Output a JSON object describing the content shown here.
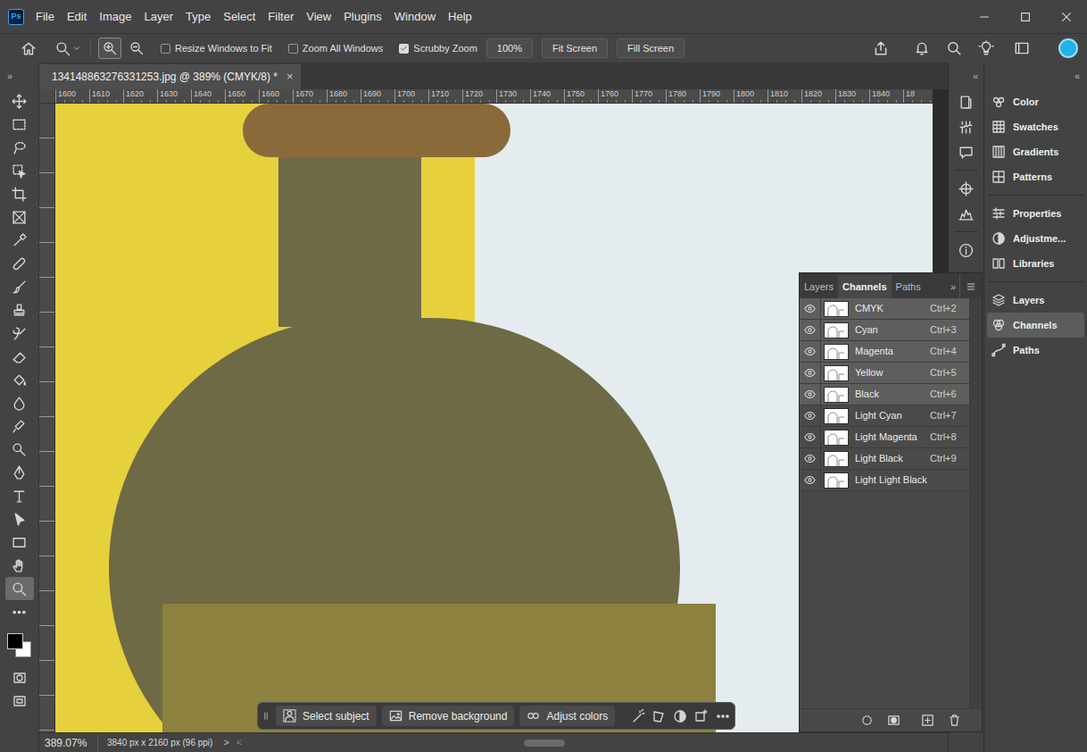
{
  "app": {
    "logo": "Ps"
  },
  "menu": [
    "File",
    "Edit",
    "Image",
    "Layer",
    "Type",
    "Select",
    "Filter",
    "View",
    "Plugins",
    "Window",
    "Help"
  ],
  "options_bar": {
    "zoom_modes": [
      {
        "selected": true
      },
      {
        "selected": false
      }
    ],
    "checkboxes": [
      {
        "label": "Resize Windows to Fit",
        "checked": false
      },
      {
        "label": "Zoom All Windows",
        "checked": false
      },
      {
        "label": "Scrubby Zoom",
        "checked": true
      }
    ],
    "buttons": [
      "100%",
      "Fit Screen",
      "Fill Screen"
    ]
  },
  "collapse": {
    "toolbar": "»",
    "strip": "«",
    "panel": "«"
  },
  "document_tab": {
    "title": "134148863276331253.jpg @ 389% (CMYK/8) *",
    "close": "×"
  },
  "ruler": {
    "ticks": [
      "1600",
      "1610",
      "1620",
      "1630",
      "1640",
      "1650",
      "1660",
      "1670",
      "1680",
      "1690",
      "1700",
      "1710",
      "1720",
      "1730",
      "1740",
      "1750",
      "1760",
      "1770",
      "1780",
      "1790",
      "1800",
      "1810",
      "1820",
      "1830",
      "1840",
      "18"
    ]
  },
  "tools": [
    {
      "selected": false
    },
    {
      "selected": false
    },
    {
      "selected": false
    },
    {
      "selected": false
    },
    {
      "selected": false
    },
    {
      "selected": false
    },
    {
      "selected": false
    },
    {
      "selected": false
    },
    {
      "selected": false
    },
    {
      "selected": false
    },
    {
      "selected": false
    },
    {
      "selected": false
    },
    {
      "selected": false
    },
    {
      "selected": false
    },
    {
      "selected": false
    },
    {
      "selected": false
    },
    {
      "selected": false
    },
    {
      "selected": false
    },
    {
      "selected": false
    },
    {
      "selected": false
    },
    {
      "selected": false
    },
    {
      "selected": true
    },
    {
      "selected": false
    }
  ],
  "channels_panel": {
    "tabs": [
      {
        "label": "Layers",
        "selected": false
      },
      {
        "label": "Channels",
        "selected": true
      },
      {
        "label": "Paths",
        "selected": false
      }
    ],
    "more": "»",
    "channels": [
      {
        "name": "CMYK",
        "shortcut": "Ctrl+2",
        "selected": true,
        "visible": true
      },
      {
        "name": "Cyan",
        "shortcut": "Ctrl+3",
        "selected": true,
        "visible": true
      },
      {
        "name": "Magenta",
        "shortcut": "Ctrl+4",
        "selected": true,
        "visible": true
      },
      {
        "name": "Yellow",
        "shortcut": "Ctrl+5",
        "selected": true,
        "visible": true
      },
      {
        "name": "Black",
        "shortcut": "Ctrl+6",
        "selected": true,
        "visible": true
      },
      {
        "name": "Light Cyan",
        "shortcut": "Ctrl+7",
        "selected": false,
        "visible": true
      },
      {
        "name": "Light Magenta",
        "shortcut": "Ctrl+8",
        "selected": false,
        "visible": true
      },
      {
        "name": "Light Black",
        "shortcut": "Ctrl+9",
        "selected": false,
        "visible": true
      },
      {
        "name": "Light Light Black",
        "shortcut": "",
        "selected": false,
        "visible": true
      }
    ]
  },
  "right_panel": {
    "groups": [
      [
        {
          "label": "Color",
          "selected": false
        },
        {
          "label": "Swatches",
          "selected": false
        },
        {
          "label": "Gradients",
          "selected": false
        },
        {
          "label": "Patterns",
          "selected": false
        }
      ],
      [
        {
          "label": "Properties",
          "selected": false
        },
        {
          "label": "Adjustme...",
          "selected": false
        },
        {
          "label": "Libraries",
          "selected": false
        }
      ],
      [
        {
          "label": "Layers",
          "selected": false
        },
        {
          "label": "Channels",
          "selected": true
        },
        {
          "label": "Paths",
          "selected": false
        }
      ]
    ]
  },
  "task_bar": {
    "buttons": [
      "Select subject",
      "Remove background",
      "Adjust colors"
    ]
  },
  "status_bar": {
    "zoom": "389.07%",
    "size": "3840 px x 2160 px (96 ppi)",
    "arrow": ">",
    "scroll_arrow": "<"
  }
}
